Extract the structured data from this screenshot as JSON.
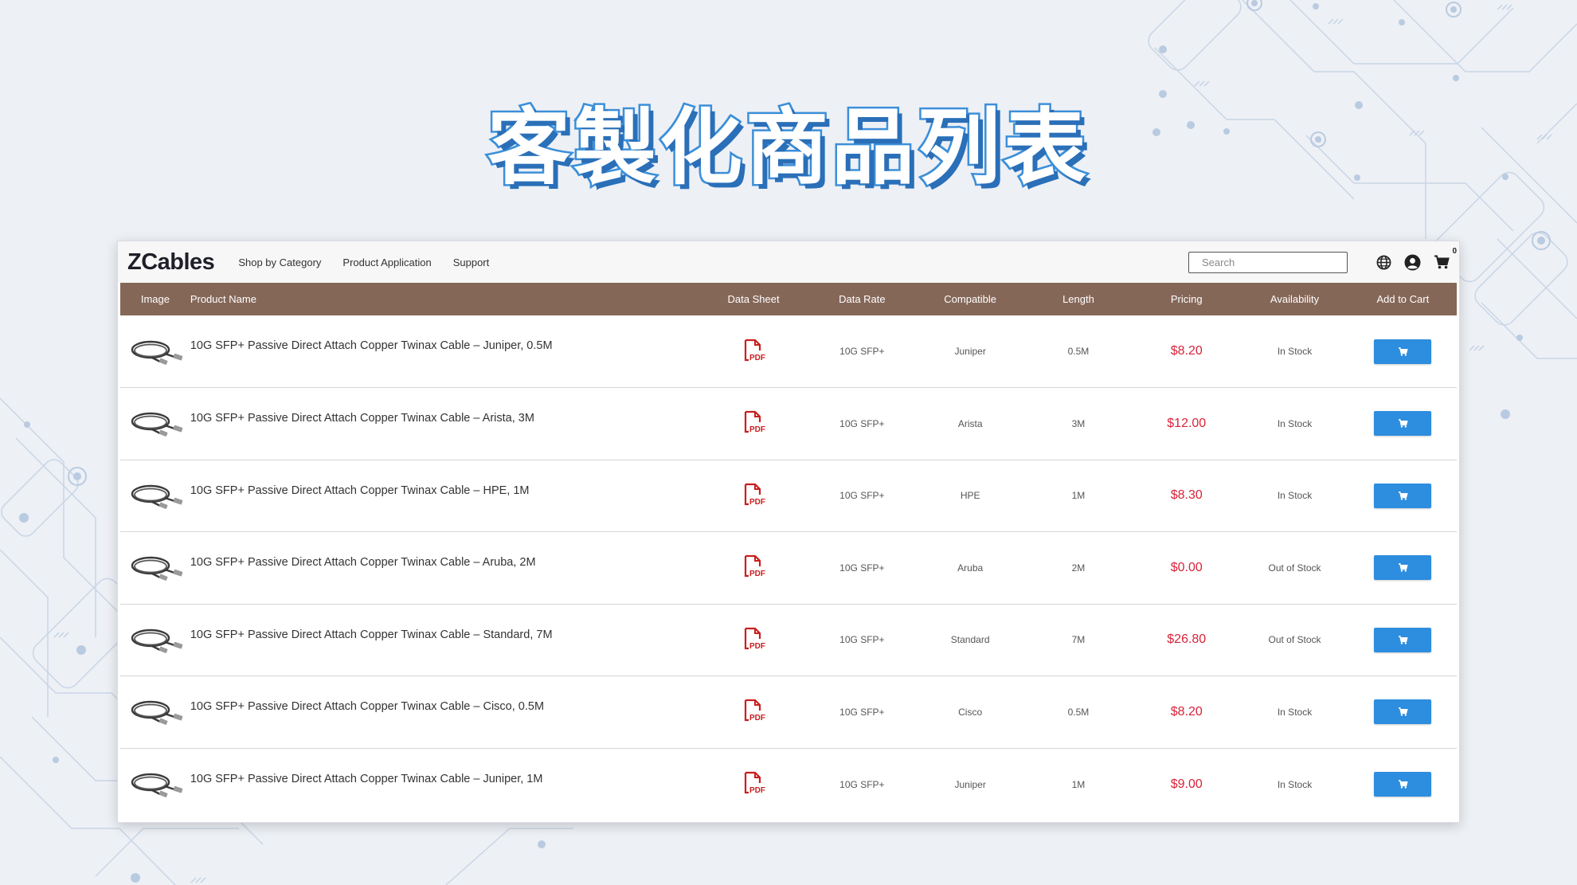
{
  "hero": {
    "title": "客製化商品列表"
  },
  "nav": {
    "logo": "ZCables",
    "links": [
      "Shop by Category",
      "Product Application",
      "Support"
    ],
    "search_placeholder": "Search",
    "cart_count": "0"
  },
  "table": {
    "headers": [
      "Image",
      "Product Name",
      "Data Sheet",
      "Data Rate",
      "Compatible",
      "Length",
      "Pricing",
      "Availability",
      "Add to Cart"
    ],
    "rows": [
      {
        "name": "10G SFP+ Passive Direct Attach Copper Twinax Cable – Juniper, 0.5M",
        "data_rate": "10G SFP+",
        "compatible": "Juniper",
        "length": "0.5M",
        "price": "$8.20",
        "availability": "In Stock"
      },
      {
        "name": "10G SFP+ Passive Direct Attach Copper Twinax Cable – Arista, 3M",
        "data_rate": "10G SFP+",
        "compatible": "Arista",
        "length": "3M",
        "price": "$12.00",
        "availability": "In Stock"
      },
      {
        "name": "10G SFP+ Passive Direct Attach Copper Twinax Cable – HPE, 1M",
        "data_rate": "10G SFP+",
        "compatible": "HPE",
        "length": "1M",
        "price": "$8.30",
        "availability": "In Stock"
      },
      {
        "name": "10G SFP+ Passive Direct Attach Copper Twinax Cable – Aruba, 2M",
        "data_rate": "10G SFP+",
        "compatible": "Aruba",
        "length": "2M",
        "price": "$0.00",
        "availability": "Out of Stock"
      },
      {
        "name": "10G SFP+ Passive Direct Attach Copper Twinax Cable – Standard, 7M",
        "data_rate": "10G SFP+",
        "compatible": "Standard",
        "length": "7M",
        "price": "$26.80",
        "availability": "Out of Stock"
      },
      {
        "name": "10G SFP+ Passive Direct Attach Copper Twinax Cable – Cisco, 0.5M",
        "data_rate": "10G SFP+",
        "compatible": "Cisco",
        "length": "0.5M",
        "price": "$8.20",
        "availability": "In Stock"
      },
      {
        "name": "10G SFP+ Passive Direct Attach Copper Twinax Cable – Juniper, 1M",
        "data_rate": "10G SFP+",
        "compatible": "Juniper",
        "length": "1M",
        "price": "$9.00",
        "availability": "In Stock"
      }
    ]
  },
  "icons": {
    "row_image": "cable-icon",
    "data_sheet": "pdf-icon",
    "add_to_cart": "cart-icon",
    "search": "search-icon",
    "language": "globe-icon",
    "account": "user-icon",
    "cart": "cart-icon"
  },
  "colors": {
    "header_bg": "#856758",
    "price": "#d8233a",
    "button": "#2d8ddf",
    "pdf": "#c8201e",
    "hero_outline": "#3b8fd9"
  }
}
